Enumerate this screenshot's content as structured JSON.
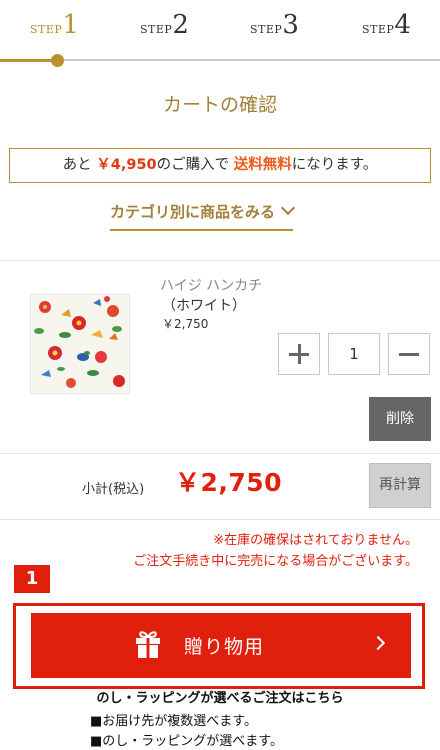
{
  "steps": [
    {
      "label": "STEP",
      "number": "1",
      "active": true
    },
    {
      "label": "STEP",
      "number": "2",
      "active": false
    },
    {
      "label": "STEP",
      "number": "3",
      "active": false
    },
    {
      "label": "STEP",
      "number": "4",
      "active": false
    }
  ],
  "page_title": "カートの確認",
  "shipping_notice": {
    "prefix": "あと",
    "amount": "￥4,950",
    "middle": "のご購入で",
    "free_shipping": "送料無料",
    "suffix": "になります。"
  },
  "category_link": "カテゴリ別に商品をみる",
  "product": {
    "name": "ハイジ ハンカチ",
    "variant": "（ホワイト）",
    "price": "￥2,750",
    "quantity": "1",
    "delete_label": "削除"
  },
  "subtotal": {
    "label": "小計(税込)",
    "value": "￥2,750",
    "recalc_label": "再計算"
  },
  "stock_note": {
    "line1": "※在庫の確保はされておりません。",
    "line2": "ご注文手続き中に完売になる場合がございます。"
  },
  "badge": "1",
  "gift_button": {
    "label": "贈り物用",
    "icon": "gift-icon"
  },
  "gift_desc": "のし・ラッピングが選べるご注文はこちら",
  "bullets": [
    "■お届け先が複数選べます。",
    "■のし・ラッピングが選べます。"
  ],
  "colors": {
    "gold": "#b8922f",
    "red": "#e0200d"
  }
}
